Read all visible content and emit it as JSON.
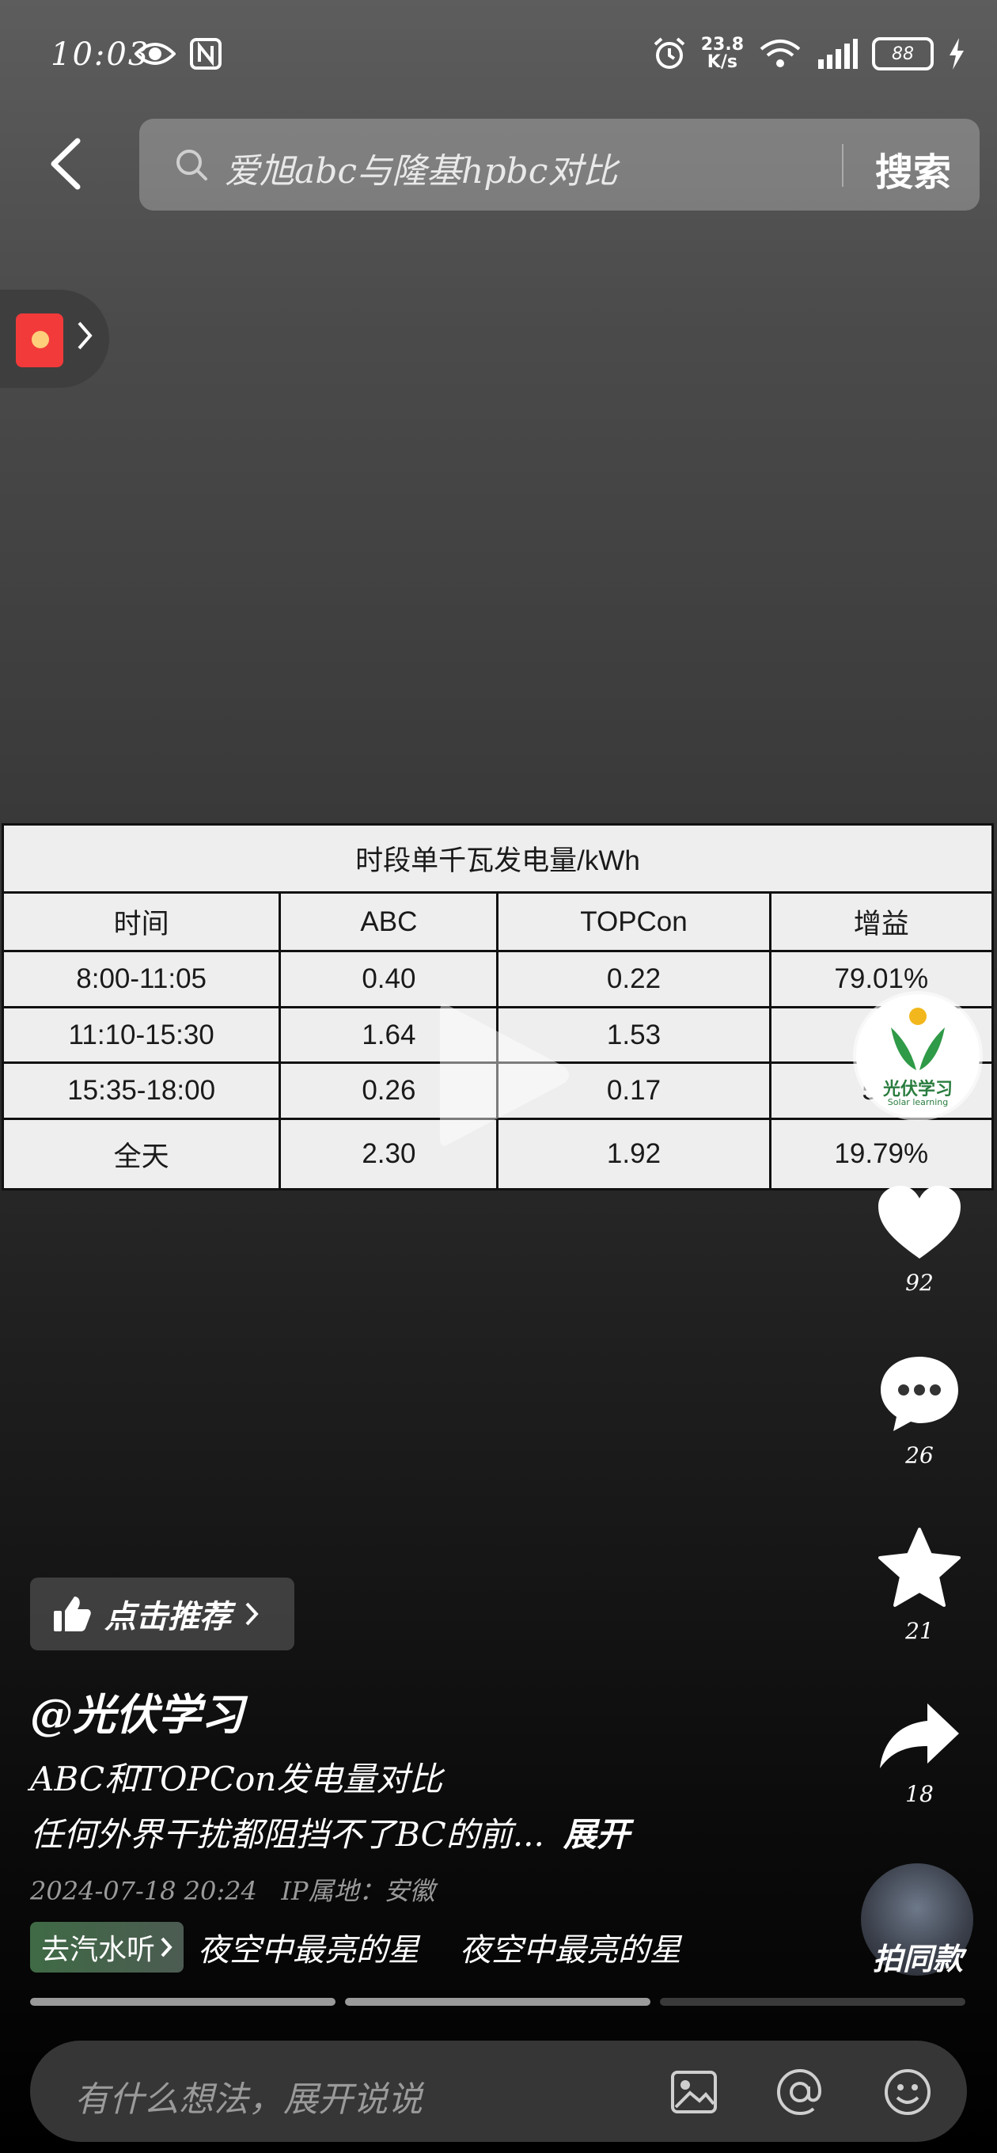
{
  "status_bar": {
    "time": "10:03",
    "net_speed_value": "23.8",
    "net_speed_unit": "K/s",
    "battery": "88"
  },
  "search": {
    "query": "爱旭abc与隆基hpbc对比",
    "button_label": "搜索"
  },
  "table": {
    "title": "时段单千瓦发电量/kWh",
    "headers": [
      "时间",
      "ABC",
      "TOPCon",
      "增益"
    ],
    "rows": [
      [
        "8:00-11:05",
        "0.40",
        "0.22",
        "79.01%"
      ],
      [
        "11:10-15:30",
        "1.64",
        "1.53",
        "7"
      ],
      [
        "15:35-18:00",
        "0.26",
        "0.17",
        "54."
      ],
      [
        "全天",
        "2.30",
        "1.92",
        "19.79%"
      ]
    ]
  },
  "creator_logo": {
    "name": "光伏学习",
    "sub": "Solar learning"
  },
  "actions": {
    "like_count": "92",
    "comment_count": "26",
    "favorite_count": "21",
    "share_count": "18"
  },
  "video": {
    "recommend_label": "点击推荐",
    "author": "@光伏学习",
    "desc_line1": "ABC和TOPCon发电量对比",
    "desc_line2": "任何外界干扰都阻挡不了BC的前...",
    "expand_label": "展开",
    "date": "2024-07-18 20:24",
    "ip_location": "IP属地：安徽",
    "music_badge": "去汽水听",
    "music_title": "夜空中最亮的星    夜空中最亮的星",
    "same_label": "拍同款"
  },
  "comment": {
    "placeholder": "有什么想法，展开说说"
  },
  "colors": {
    "red_packet": "#f23a3a",
    "logo_green": "#2a7d3f"
  }
}
